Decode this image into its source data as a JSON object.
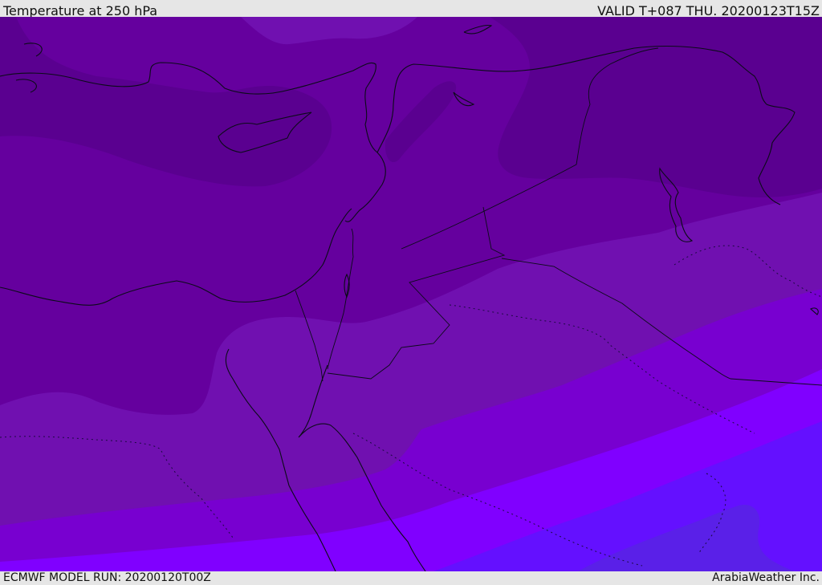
{
  "header": {
    "title": "Temperature at 250 hPa",
    "valid": "VALID T+087 THU. 20200123T15Z"
  },
  "footer": {
    "model_run": "ECMWF MODEL RUN: 20200120T00Z",
    "credit": "ArabiaWeather Inc."
  },
  "map": {
    "colors": {
      "darkest": "#5a0090",
      "dark": "#65009e",
      "mid": "#7010b0",
      "violet": "#7800d0",
      "bright": "#8000ff",
      "blue": "#6410ff",
      "deep_blue": "#5a20e8"
    }
  }
}
